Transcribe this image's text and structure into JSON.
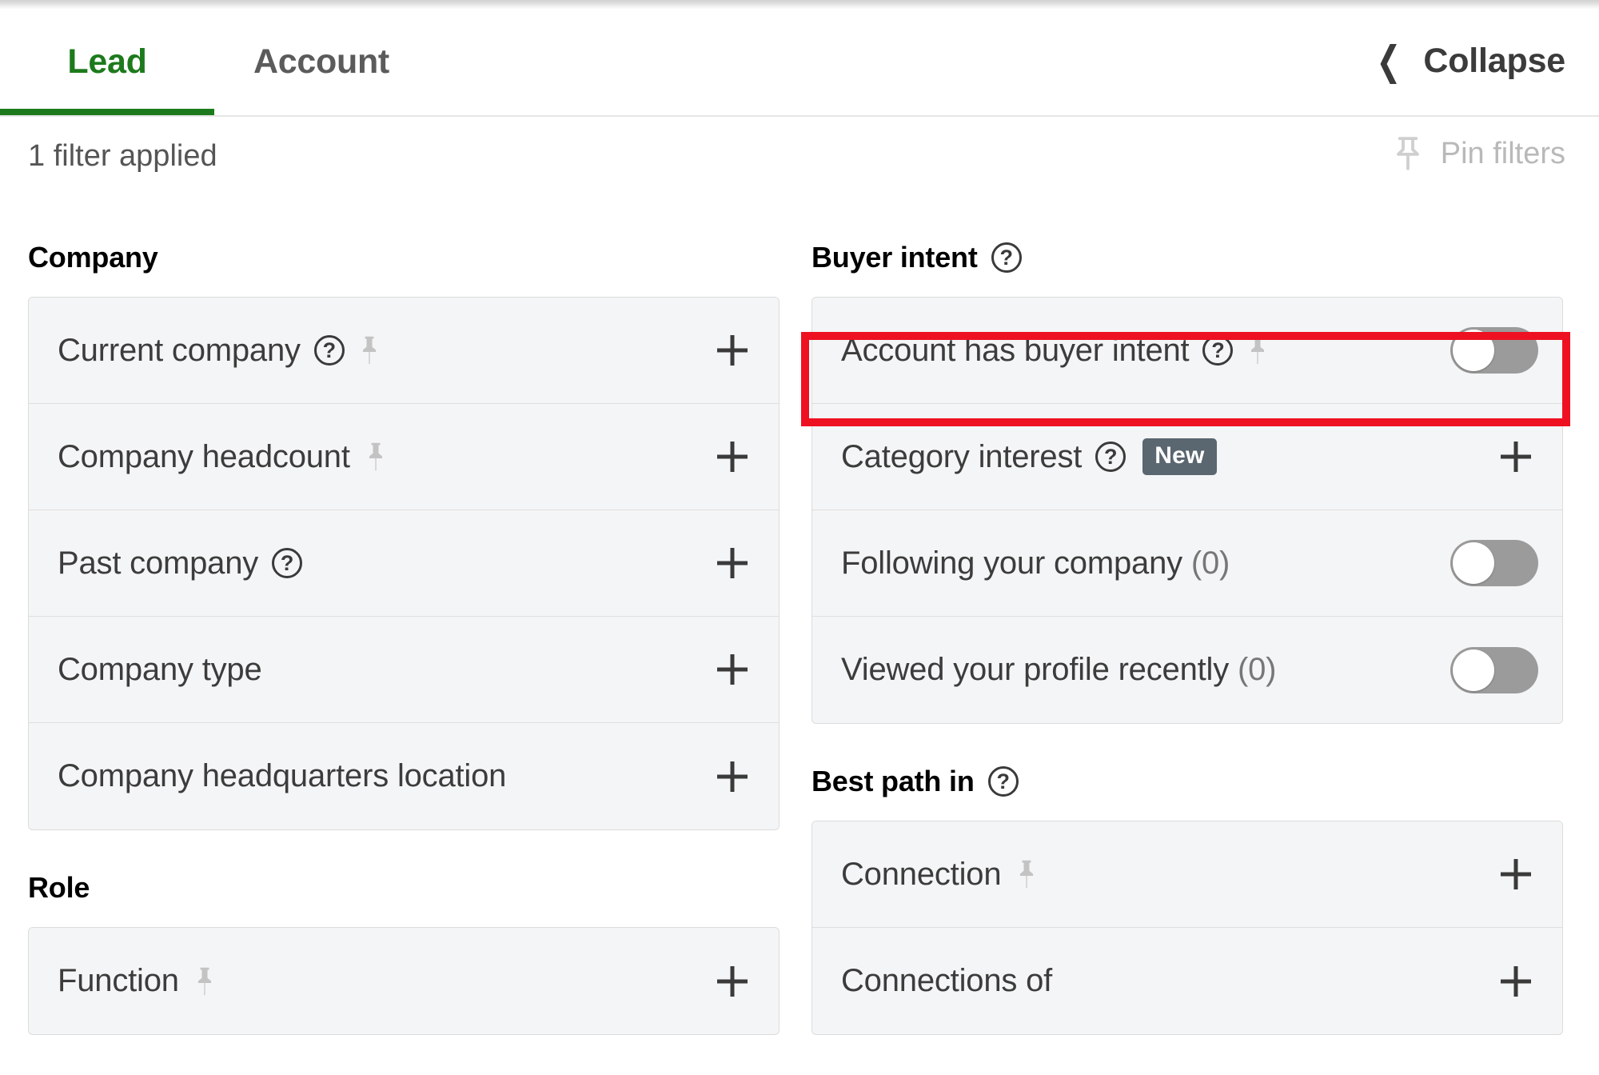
{
  "header": {
    "tabs": [
      {
        "label": "Lead",
        "active": true
      },
      {
        "label": "Account",
        "active": false
      }
    ],
    "collapse_label": "Collapse",
    "collapse_icon": "chevron-left-icon"
  },
  "status_bar": {
    "filters_applied": "1 filter applied",
    "pin_filters_label": "Pin filters",
    "pin_filters_icon": "pin-icon"
  },
  "accent_colors": {
    "tab_active": "#1d7a1c",
    "new_badge_bg": "#5a6670",
    "highlight_box": "#ee1122",
    "panel_bg": "#f4f5f6",
    "panel_border": "#dcdcdc"
  },
  "left_column": {
    "sections": [
      {
        "title": "Company",
        "rows": [
          {
            "label": "Current company",
            "help": true,
            "pin": true,
            "control": "plus"
          },
          {
            "label": "Company headcount",
            "help": false,
            "pin": true,
            "control": "plus"
          },
          {
            "label": "Past company",
            "help": true,
            "pin": false,
            "control": "plus"
          },
          {
            "label": "Company type",
            "help": false,
            "pin": false,
            "control": "plus"
          },
          {
            "label": "Company headquarters location",
            "help": false,
            "pin": false,
            "control": "plus"
          }
        ]
      },
      {
        "title": "Role",
        "rows": [
          {
            "label": "Function",
            "help": false,
            "pin": true,
            "control": "plus"
          }
        ]
      }
    ]
  },
  "right_column": {
    "sections": [
      {
        "title": "Buyer intent",
        "help": true,
        "rows": [
          {
            "label": "Account has buyer intent",
            "help": true,
            "pin": true,
            "badge": null,
            "control": "toggle",
            "toggle_on": false
          },
          {
            "label": "Category interest",
            "help": true,
            "pin": false,
            "badge": "New",
            "control": "plus",
            "highlighted": true
          },
          {
            "label": "Following your company",
            "suffix": " (0)",
            "help": false,
            "pin": false,
            "badge": null,
            "control": "toggle",
            "toggle_on": false
          },
          {
            "label": "Viewed your profile recently",
            "suffix": " (0)",
            "help": false,
            "pin": false,
            "badge": null,
            "control": "toggle",
            "toggle_on": false
          }
        ]
      },
      {
        "title": "Best path in",
        "help": true,
        "rows": [
          {
            "label": "Connection",
            "help": false,
            "pin": true,
            "badge": null,
            "control": "plus"
          },
          {
            "label": "Connections of",
            "help": false,
            "pin": false,
            "badge": null,
            "control": "plus"
          }
        ]
      }
    ]
  }
}
